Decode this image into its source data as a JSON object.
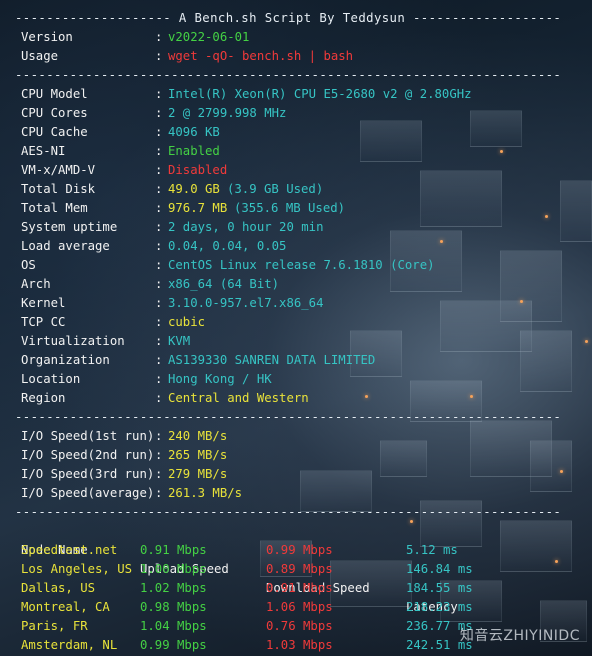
{
  "header_sep": "-------------------- A Bench.sh Script By Teddysun -------------------",
  "sep": "----------------------------------------------------------------------",
  "meta": [
    {
      "key": "Version",
      "value": "v2022-06-01",
      "color": "#44d144"
    },
    {
      "key": "Usage",
      "value": "wget -qO- bench.sh | bash",
      "color": "#f03a3a"
    }
  ],
  "system": [
    {
      "key": "CPU Model",
      "value": "Intel(R) Xeon(R) CPU E5-2680 v2 @ 2.80GHz",
      "color": "#36c4c4"
    },
    {
      "key": "CPU Cores",
      "value": "2 @ 2799.998 MHz",
      "color": "#36c4c4"
    },
    {
      "key": "CPU Cache",
      "value": "4096 KB",
      "color": "#36c4c4"
    },
    {
      "key": "AES-NI",
      "value": "Enabled",
      "color": "#44d144"
    },
    {
      "key": "VM-x/AMD-V",
      "value": "Disabled",
      "color": "#f03a3a"
    },
    {
      "key": "Total Disk",
      "value": "49.0 GB",
      "extra": "(3.9 GB Used)",
      "color": "#e8e23a"
    },
    {
      "key": "Total Mem",
      "value": "976.7 MB",
      "extra": "(355.6 MB Used)",
      "color": "#e8e23a"
    },
    {
      "key": "System uptime",
      "value": "2 days, 0 hour 20 min",
      "color": "#36c4c4"
    },
    {
      "key": "Load average",
      "value": "0.04, 0.04, 0.05",
      "color": "#36c4c4"
    },
    {
      "key": "OS",
      "value": "CentOS Linux release 7.6.1810 (Core)",
      "color": "#36c4c4"
    },
    {
      "key": "Arch",
      "value": "x86_64 (64 Bit)",
      "color": "#36c4c4"
    },
    {
      "key": "Kernel",
      "value": "3.10.0-957.el7.x86_64",
      "color": "#36c4c4"
    },
    {
      "key": "TCP CC",
      "value": "cubic",
      "color": "#e8e23a"
    },
    {
      "key": "Virtualization",
      "value": "KVM",
      "color": "#36c4c4"
    },
    {
      "key": "Organization",
      "value": "AS139330 SANREN DATA LIMITED",
      "color": "#36c4c4"
    },
    {
      "key": "Location",
      "value": "Hong Kong / HK",
      "color": "#36c4c4"
    },
    {
      "key": "Region",
      "value": "Central and Western",
      "color": "#e8e23a"
    }
  ],
  "io": [
    {
      "key": "I/O Speed(1st run)",
      "value": "240 MB/s"
    },
    {
      "key": "I/O Speed(2nd run)",
      "value": "265 MB/s"
    },
    {
      "key": "I/O Speed(3rd run)",
      "value": "279 MB/s"
    },
    {
      "key": "I/O Speed(average)",
      "value": "261.3 MB/s"
    }
  ],
  "speed_header": {
    "node": "Node Name",
    "upload": "Upload Speed",
    "download": "Download Speed",
    "latency": "Latency"
  },
  "speed_rows": [
    {
      "node": "Speedtest.net",
      "upload": "0.91 Mbps",
      "download": "0.99 Mbps",
      "latency": "5.12 ms"
    },
    {
      "node": "Los Angeles, US",
      "upload": "1.00 Mbps",
      "download": "0.89 Mbps",
      "latency": "146.84 ms"
    },
    {
      "node": "Dallas, US",
      "upload": "1.02 Mbps",
      "download": "0.91 Mbps",
      "latency": "184.55 ms"
    },
    {
      "node": "Montreal, CA",
      "upload": "0.98 Mbps",
      "download": "1.06 Mbps",
      "latency": "218.23 ms"
    },
    {
      "node": "Paris, FR",
      "upload": "1.04 Mbps",
      "download": "0.76 Mbps",
      "latency": "236.77 ms"
    },
    {
      "node": "Amsterdam, NL",
      "upload": "0.99 Mbps",
      "download": "1.03 Mbps",
      "latency": "242.51 ms"
    }
  ],
  "colors": {
    "key": "#f2f2f2",
    "cyan": "#36c4c4",
    "green": "#44d144",
    "red": "#f03a3a",
    "yellow": "#e8e23a"
  },
  "watermark": "知音云ZHIYINIDC"
}
